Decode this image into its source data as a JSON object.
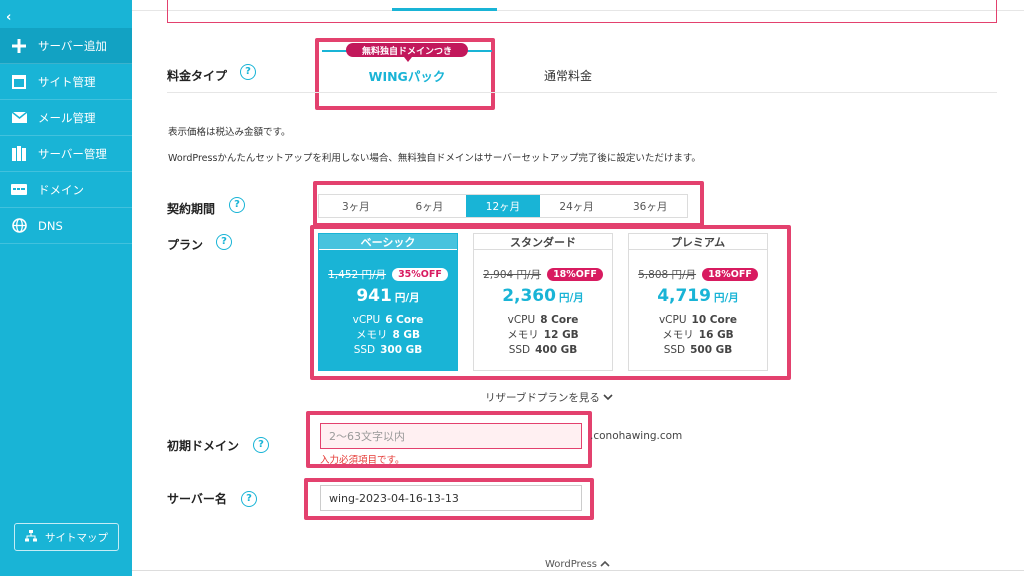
{
  "sidebar": {
    "collapse_icon": "chevron-left-icon",
    "items": [
      {
        "label": "サーバー追加",
        "icon": "plus-icon"
      },
      {
        "label": "サイト管理",
        "icon": "window-icon"
      },
      {
        "label": "メール管理",
        "icon": "mail-icon"
      },
      {
        "label": "サーバー管理",
        "icon": "server-icon"
      },
      {
        "label": "ドメイン",
        "icon": "domain-icon"
      },
      {
        "label": "DNS",
        "icon": "globe-icon"
      }
    ],
    "sitemap_label": "サイトマップ"
  },
  "price_type": {
    "label": "料金タイプ",
    "badge": "無料独自ドメインつき",
    "wing_tab": "WINGパック",
    "normal_tab": "通常料金"
  },
  "notes": {
    "tax": "表示価格は税込み金額です。",
    "domain_note": "WordPressかんたんセットアップを利用しない場合、無料独自ドメインはサーバーセットアップ完了後に設定いただけます。"
  },
  "period": {
    "label": "契約期間",
    "options": [
      "3ヶ月",
      "6ヶ月",
      "12ヶ月",
      "24ヶ月",
      "36ヶ月"
    ],
    "selected": "12ヶ月"
  },
  "plan": {
    "label": "プラン",
    "plans": [
      {
        "name": "ベーシック",
        "old_price": "1,452 円/月",
        "discount": "35%OFF",
        "price": "941",
        "unit": "円/月",
        "vcpu_label": "vCPU",
        "vcpu": "6 Core",
        "mem_label": "メモリ",
        "mem": "8 GB",
        "ssd_label": "SSD",
        "ssd": "300 GB"
      },
      {
        "name": "スタンダード",
        "old_price": "2,904 円/月",
        "discount": "18%OFF",
        "price": "2,360",
        "unit": "円/月",
        "vcpu_label": "vCPU",
        "vcpu": "8 Core",
        "mem_label": "メモリ",
        "mem": "12 GB",
        "ssd_label": "SSD",
        "ssd": "400 GB"
      },
      {
        "name": "プレミアム",
        "old_price": "5,808 円/月",
        "discount": "18%OFF",
        "price": "4,719",
        "unit": "円/月",
        "vcpu_label": "vCPU",
        "vcpu": "10 Core",
        "mem_label": "メモリ",
        "mem": "16 GB",
        "ssd_label": "SSD",
        "ssd": "500 GB"
      }
    ],
    "selected": "ベーシック",
    "reserved_link": "リザーブドプランを見る"
  },
  "initial_domain": {
    "label": "初期ドメイン",
    "placeholder": "2～63文字以内",
    "value": "",
    "suffix": ".conohawing.com",
    "error": "入力必須項目です。"
  },
  "server_name": {
    "label": "サーバー名",
    "value": "wing-2023-04-16-13-13"
  },
  "wordpress_toggle": {
    "label": "WordPress",
    "icon": "chevron-up-icon"
  },
  "colors": {
    "accent": "#19b4d6",
    "highlight": "#e3416e",
    "badge": "#c2185b",
    "error": "#e53935"
  }
}
